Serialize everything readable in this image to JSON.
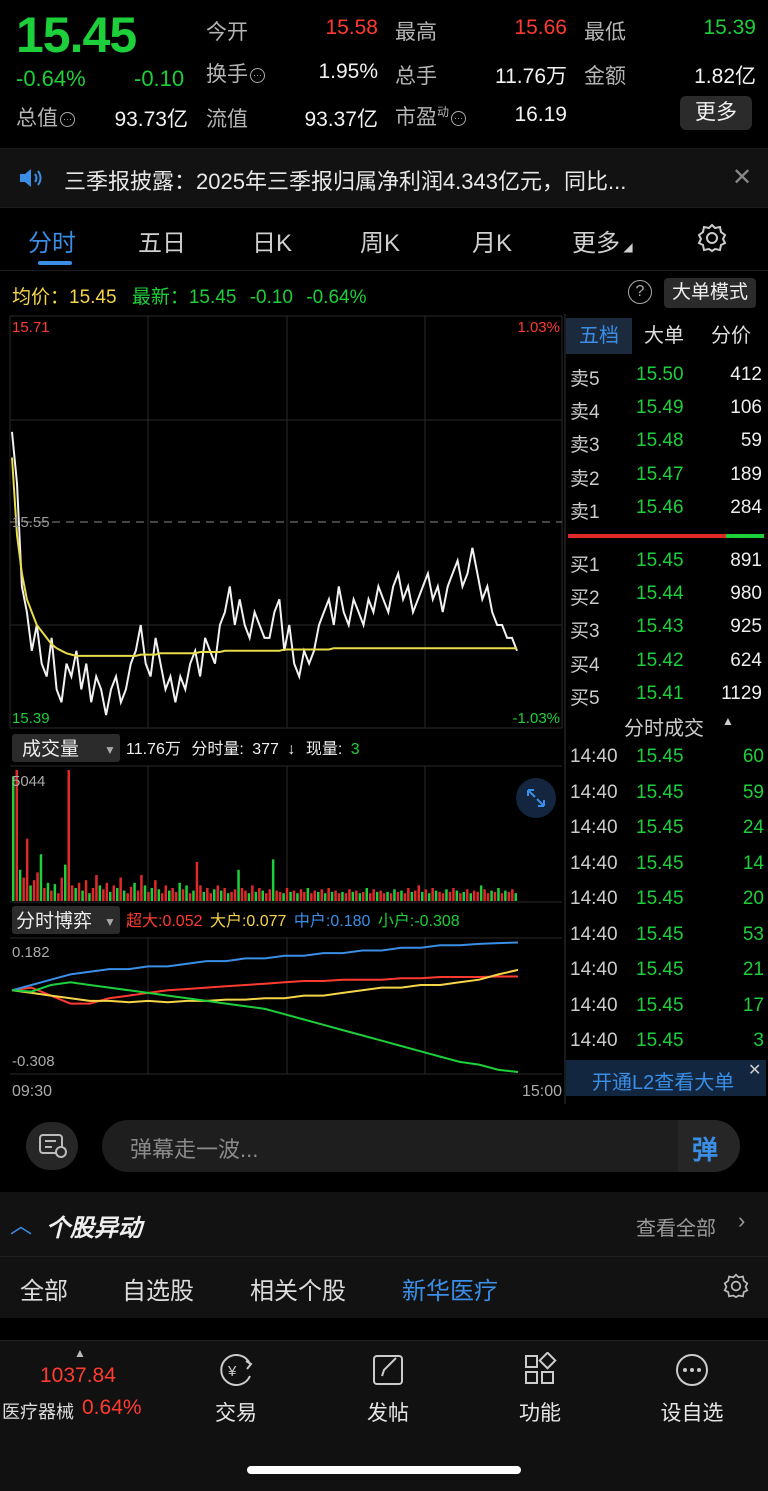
{
  "quote": {
    "price": "15.45",
    "change_pct": "-0.64%",
    "change": "-0.10",
    "fields": [
      {
        "label": "今开",
        "value": "15.58",
        "color": "red"
      },
      {
        "label": "最高",
        "value": "15.66",
        "color": "red"
      },
      {
        "label": "最低",
        "value": "15.39",
        "color": "green"
      },
      {
        "label": "换手",
        "value": "1.95%",
        "color": "white"
      },
      {
        "label": "总手",
        "value": "11.76万",
        "color": "white"
      },
      {
        "label": "金额",
        "value": "1.82亿",
        "color": "white"
      },
      {
        "label": "总值",
        "value": "93.73亿",
        "color": "white"
      },
      {
        "label": "流值",
        "value": "93.37亿",
        "color": "white"
      },
      {
        "label": "市盈",
        "sup": "动",
        "value": "16.19",
        "color": "white"
      }
    ],
    "more_button": "更多"
  },
  "notice": {
    "text": "三季报披露：2025年三季报归属净利润4.343亿元，同比...",
    "icon": "speaker-icon"
  },
  "tabs": [
    "分时",
    "五日",
    "日K",
    "周K",
    "月K",
    "更多"
  ],
  "active_tab": 0,
  "info_row": {
    "avg_label": "均价：",
    "avg_value": "15.45",
    "latest_label": "最新：",
    "latest_value": "15.45",
    "latest_change": "-0.10",
    "latest_pct": "-0.64%",
    "mode_button": "大单模式"
  },
  "chart_data": [
    {
      "type": "line",
      "name": "price",
      "x_range": [
        "09:30",
        "15:00"
      ],
      "ylim": [
        15.39,
        15.71
      ],
      "y_labels": {
        "top": "15.71",
        "mid": "15.55",
        "bottom": "15.39",
        "top_pct": "1.03%",
        "bottom_pct": "-1.03%"
      },
      "series": [
        {
          "values": [
            15.62,
            15.58,
            15.5,
            15.48,
            15.45,
            15.47,
            15.44,
            15.43,
            15.46,
            15.42,
            15.41,
            15.44,
            15.43,
            15.45,
            15.42,
            15.44,
            15.41,
            15.43,
            15.42,
            15.4,
            15.42,
            15.43,
            15.41,
            15.42,
            15.44,
            15.45,
            15.47,
            15.44,
            15.43,
            15.46,
            15.44,
            15.42,
            15.43,
            15.41,
            15.43,
            15.42,
            15.44,
            15.45,
            15.43,
            15.46,
            15.45,
            15.44,
            15.47,
            15.48,
            15.5,
            15.47,
            15.49,
            15.47,
            15.46,
            15.48,
            15.47,
            15.46,
            15.46,
            15.48,
            15.49,
            15.45,
            15.47,
            15.44,
            15.43,
            15.45,
            15.44,
            15.45,
            15.47,
            15.48,
            15.49,
            15.47,
            15.5,
            15.48,
            15.47,
            15.49,
            15.48,
            15.47,
            15.49,
            15.48,
            15.5,
            15.49,
            15.48,
            15.5,
            15.51,
            15.49,
            15.5,
            15.48,
            15.49,
            15.5,
            15.51,
            15.49,
            15.5,
            15.48,
            15.5,
            15.51,
            15.52,
            15.5,
            15.51,
            15.53,
            15.51,
            15.49,
            15.5,
            15.48,
            15.47,
            15.47,
            15.46,
            15.46,
            15.45
          ]
        },
        {
          "values": [
            15.6,
            15.54,
            15.51,
            15.49,
            15.48,
            15.47,
            15.465,
            15.46,
            15.455,
            15.452,
            15.45,
            15.448,
            15.447,
            15.446,
            15.446,
            15.446,
            15.446,
            15.446,
            15.446,
            15.446,
            15.446,
            15.446,
            15.446,
            15.446,
            15.446,
            15.446,
            15.447,
            15.447,
            15.447,
            15.447,
            15.448,
            15.448,
            15.448,
            15.448,
            15.448,
            15.448,
            15.448,
            15.448,
            15.449,
            15.449,
            15.449,
            15.449,
            15.449,
            15.45,
            15.45,
            15.45,
            15.45,
            15.45,
            15.45,
            15.45,
            15.45,
            15.45,
            15.45,
            15.45,
            15.45,
            15.451,
            15.451,
            15.451,
            15.451,
            15.451,
            15.451,
            15.451,
            15.451,
            15.451,
            15.451,
            15.452,
            15.452,
            15.452,
            15.452,
            15.452,
            15.452,
            15.452,
            15.452,
            15.452,
            15.452,
            15.452,
            15.452,
            15.452,
            15.452,
            15.452,
            15.452,
            15.452,
            15.452,
            15.452,
            15.452,
            15.452,
            15.452,
            15.452,
            15.452,
            15.452,
            15.452,
            15.452,
            15.452,
            15.452,
            15.452,
            15.452,
            15.452,
            15.452,
            15.452,
            15.452,
            15.452,
            15.452,
            15.452
          ]
        }
      ],
      "colors": {
        "price": "#f2f2f2",
        "avg": "#e8dc4a"
      }
    },
    {
      "type": "bar",
      "name": "volume",
      "label": "成交量",
      "summary": "11.76万",
      "minute_label": "分时量:",
      "minute_value": "377",
      "minute_arrow": "↓",
      "now_label": "现量:",
      "now_value": "3",
      "ymax_label": "5044",
      "ylim": [
        0,
        5044
      ],
      "values": [
        4800,
        5044,
        1200,
        900,
        2400,
        600,
        800,
        1100,
        1800,
        500,
        700,
        400,
        650,
        300,
        900,
        1400,
        5044,
        600,
        500,
        700,
        400,
        800,
        300,
        500,
        1000,
        600,
        450,
        700,
        350,
        600,
        500,
        900,
        400,
        300,
        550,
        700,
        400,
        1000,
        600,
        350,
        500,
        800,
        450,
        300,
        600,
        400,
        500,
        350,
        700,
        450,
        600,
        300,
        400,
        1500,
        600,
        350,
        500,
        300,
        450,
        600,
        400,
        500,
        300,
        350,
        450,
        1200,
        500,
        400,
        300,
        600,
        350,
        500,
        400,
        300,
        450,
        1600,
        400,
        350,
        300,
        500,
        350,
        400,
        300,
        450,
        350,
        500,
        300,
        400,
        350,
        450,
        300,
        500,
        350,
        400,
        300,
        350,
        300,
        450,
        350,
        400,
        300,
        350,
        500,
        300,
        450,
        350,
        400,
        300,
        350,
        300,
        450,
        350,
        400,
        300,
        500,
        350,
        400,
        600,
        350,
        450,
        300,
        500,
        400,
        350,
        300,
        450,
        350,
        500,
        400,
        300,
        350,
        450,
        300,
        400,
        350,
        600,
        450,
        300,
        400,
        350,
        500,
        300,
        400,
        350,
        450,
        300
      ],
      "colors_pattern": [
        "green",
        "red",
        "green",
        "red",
        "red",
        "green",
        "red",
        "red",
        "green",
        "red"
      ]
    },
    {
      "type": "line",
      "name": "capital-game",
      "label": "分时博弈",
      "legend": [
        {
          "label": "超大:",
          "value": "0.052",
          "color": "#ff3b30"
        },
        {
          "label": "大户:",
          "value": "0.077",
          "color": "#f5d547"
        },
        {
          "label": "中户:",
          "value": "0.180",
          "color": "#3a8ee6"
        },
        {
          "label": "小户:",
          "value": "-0.308",
          "color": "#1dcf3a"
        }
      ],
      "y_labels": {
        "top": "0.182",
        "bottom": "-0.308"
      },
      "x_labels": [
        "09:30",
        "15:00"
      ],
      "ylim": [
        -0.308,
        0.182
      ],
      "series": [
        {
          "name": "超大",
          "color": "#ff3b30",
          "values": [
            0,
            0.01,
            -0.02,
            -0.05,
            -0.05,
            -0.03,
            -0.02,
            -0.01,
            0,
            0.005,
            0.01,
            0.015,
            0.02,
            0.025,
            0.03,
            0.035,
            0.035,
            0.04,
            0.04,
            0.04,
            0.045,
            0.045,
            0.05,
            0.05,
            0.05,
            0.052,
            0.052
          ]
        },
        {
          "name": "大户",
          "color": "#f5d547",
          "values": [
            0,
            -0.01,
            -0.02,
            -0.03,
            -0.04,
            -0.04,
            -0.045,
            -0.04,
            -0.045,
            -0.04,
            -0.04,
            -0.035,
            -0.035,
            -0.03,
            -0.03,
            -0.02,
            -0.02,
            -0.01,
            0,
            0.01,
            0.01,
            0.02,
            0.02,
            0.03,
            0.04,
            0.06,
            0.077
          ]
        },
        {
          "name": "中户",
          "color": "#3a8ee6",
          "values": [
            0,
            0.02,
            0.04,
            0.06,
            0.07,
            0.08,
            0.08,
            0.09,
            0.09,
            0.1,
            0.11,
            0.11,
            0.12,
            0.12,
            0.13,
            0.13,
            0.14,
            0.14,
            0.15,
            0.15,
            0.16,
            0.16,
            0.17,
            0.17,
            0.175,
            0.178,
            0.18
          ]
        },
        {
          "name": "小户",
          "color": "#1dcf3a",
          "values": [
            0,
            -0.005,
            0.02,
            0.03,
            0.02,
            0.01,
            0.0,
            -0.01,
            -0.02,
            -0.03,
            -0.04,
            -0.05,
            -0.06,
            -0.07,
            -0.09,
            -0.11,
            -0.13,
            -0.15,
            -0.17,
            -0.19,
            -0.21,
            -0.23,
            -0.25,
            -0.27,
            -0.28,
            -0.3,
            -0.308
          ]
        }
      ]
    }
  ],
  "orderbook": {
    "tabs": [
      "五档",
      "大单",
      "分价"
    ],
    "active": 0,
    "asks": [
      {
        "label": "卖5",
        "price": "15.50",
        "vol": "412"
      },
      {
        "label": "卖4",
        "price": "15.49",
        "vol": "106"
      },
      {
        "label": "卖3",
        "price": "15.48",
        "vol": "59"
      },
      {
        "label": "卖2",
        "price": "15.47",
        "vol": "189"
      },
      {
        "label": "卖1",
        "price": "15.46",
        "vol": "284"
      }
    ],
    "bids": [
      {
        "label": "买1",
        "price": "15.45",
        "vol": "891"
      },
      {
        "label": "买2",
        "price": "15.44",
        "vol": "980"
      },
      {
        "label": "买3",
        "price": "15.43",
        "vol": "925"
      },
      {
        "label": "买4",
        "price": "15.42",
        "vol": "624"
      },
      {
        "label": "买5",
        "price": "15.41",
        "vol": "1129"
      }
    ]
  },
  "trades": {
    "header": "分时成交",
    "rows": [
      {
        "time": "14:40",
        "price": "15.45",
        "vol": "60"
      },
      {
        "time": "14:40",
        "price": "15.45",
        "vol": "59"
      },
      {
        "time": "14:40",
        "price": "15.45",
        "vol": "24"
      },
      {
        "time": "14:40",
        "price": "15.45",
        "vol": "14"
      },
      {
        "time": "14:40",
        "price": "15.45",
        "vol": "20"
      },
      {
        "time": "14:40",
        "price": "15.45",
        "vol": "53"
      },
      {
        "time": "14:40",
        "price": "15.45",
        "vol": "21"
      },
      {
        "time": "14:40",
        "price": "15.45",
        "vol": "17"
      },
      {
        "time": "14:40",
        "price": "15.45",
        "vol": "3"
      }
    ],
    "l2_banner": "开通L2查看大单"
  },
  "danmu": {
    "placeholder": "弹幕走一波...",
    "send": "弹"
  },
  "movers": {
    "title": "个股异动",
    "view_all": "查看全部"
  },
  "subtabs": {
    "items": [
      "全部",
      "自选股",
      "相关个股",
      "新华医疗"
    ],
    "active": 3
  },
  "bottom_nav": {
    "sector_value": "1037.84",
    "sector_name": "医疗器械",
    "sector_pct": "0.64%",
    "items": [
      "交易",
      "发帖",
      "功能",
      "设自选"
    ]
  }
}
